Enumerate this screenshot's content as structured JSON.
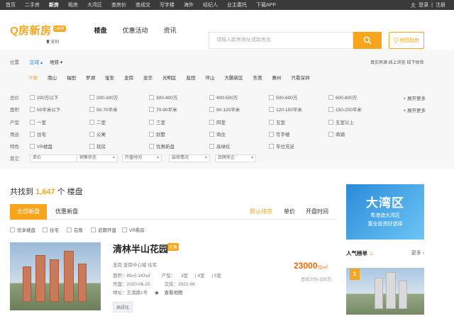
{
  "topnav": {
    "items": [
      "首页",
      "二手房",
      "新房",
      "租房",
      "大湾区",
      "查房价",
      "查成交",
      "写字楼",
      "海外",
      "经纪人",
      "业主委托",
      "下载APP"
    ],
    "active": "新房",
    "login": "登录",
    "register": "注册"
  },
  "header": {
    "logo_text": "Q房新房",
    "logo_badge": "Q房网",
    "city": "深圳",
    "tabs": [
      "楼盘",
      "优惠活动",
      "资讯"
    ],
    "active_tab": "楼盘",
    "search_placeholder": "请输入新房地址或新房名",
    "map_button": "地图找房"
  },
  "filter": {
    "position_label": "位置",
    "region_tab": "区域",
    "subway_tab": "地铁",
    "notices": "真实房源 线上浏览 线下体验",
    "districts": [
      "不限",
      "南山",
      "福田",
      "罗湖",
      "宝安",
      "龙岗",
      "龙华",
      "光明区",
      "盐田",
      "坪山",
      "大鹏新区",
      "东莞",
      "惠州",
      "只看深圳"
    ],
    "active_district": "不限",
    "total_label": "总价",
    "total_opts": [
      "200万以下",
      "200-300万",
      "300-400万",
      "400-500万",
      "500-600万",
      "600-800万"
    ],
    "area_label": "面积",
    "area_opts": [
      "50平米以下",
      "50-70平米",
      "70-90平米",
      "90-120平米",
      "120-150平米",
      "150-200平米"
    ],
    "type_label": "户型",
    "type_opts": [
      "一室",
      "二室",
      "三室",
      "四室",
      "五室",
      "五室以上"
    ],
    "usage_label": "用途",
    "usage_opts": [
      "住宅",
      "公寓",
      "别墅",
      "商住",
      "写字楼",
      "商铺"
    ],
    "feature_label": "特色",
    "feature_opts": [
      "VR楼盘",
      "现房",
      "优惠新盘",
      "高绿化",
      "车位充足"
    ],
    "other_label": "其它",
    "other_selects": [
      "单价",
      "销售状态",
      "开盘时间",
      "装修情况",
      "品牌房企"
    ],
    "expand": "展开更多"
  },
  "results": {
    "prefix": "共找到",
    "count": "1,647",
    "suffix": "个 楼盘"
  },
  "tabs": {
    "all": "全部新盘",
    "discount": "优惠新盘",
    "default_sort": "默认排序",
    "unit_price": "单价",
    "open_time": "开盘时间"
  },
  "checks": [
    "优享楼盘",
    "住宅",
    "在售",
    "近期开盘",
    "VR看房"
  ],
  "listing": {
    "title": "清林半山花园",
    "badge": "在售",
    "location": "龙岗 龙岗中心城 住宅",
    "area": "面积：89㎡-143㎡",
    "layout_prefix": "户型：",
    "layouts": [
      "3室",
      "4室",
      "5室"
    ],
    "open": "开盘：2020-06-25",
    "handover": "交房：2022-06",
    "address": "地址：五酒路1号",
    "map_link": "查看地图",
    "tag": "高绿化",
    "price": "23000",
    "price_unit": "元/㎡",
    "total": "总价205-329万"
  },
  "sidebar": {
    "ad_title": "大湾区",
    "ad_line1": "粤港澳大湾区",
    "ad_line2": "置业投资好选择",
    "hot_title": "人气榜单",
    "hot_more": "更多",
    "rank": "1"
  }
}
